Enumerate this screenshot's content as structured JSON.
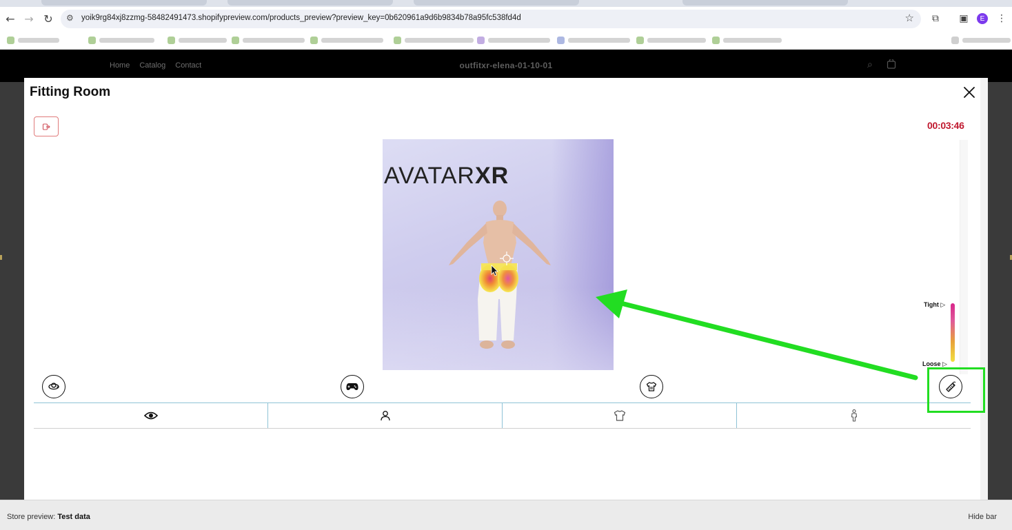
{
  "browser": {
    "url": "yoik9rg84xj8zzmg-58482491473.shopifypreview.com/products_preview?preview_key=0b620961a9d6b9834b78a95fc538fd4d",
    "profile_initial": "E",
    "icons": [
      "back-icon",
      "forward-icon",
      "reload-icon",
      "site-info-icon",
      "bookmark-star-icon",
      "extensions-icon",
      "sidepanel-icon",
      "kebab-menu-icon"
    ]
  },
  "store": {
    "nav": [
      "Home",
      "Catalog",
      "Contact"
    ],
    "title": "outfitxr-elena-01-10-01",
    "icons": [
      "search-icon",
      "cart-icon"
    ]
  },
  "modal": {
    "title": "Fitting Room",
    "timer": "00:03:46",
    "brand_logo_light": "AVATAR",
    "brand_logo_bold": "XR",
    "fit_legend": {
      "tight_label": "Tight",
      "loose_label": "Loose",
      "gradient_colors": [
        "#d8268a",
        "#e8a13a",
        "#f2e040"
      ]
    },
    "controls": [
      "rotate-icon",
      "gamepad-icon",
      "shirt-swap-icon",
      "measuring-tape-icon"
    ],
    "tabs": [
      "eye-icon",
      "person-icon",
      "tshirt-icon",
      "body-figure-icon"
    ]
  },
  "preview_bar": {
    "label": "Store preview:",
    "value": "Test data",
    "hide": "Hide bar"
  },
  "colors": {
    "timer": "#c0192f",
    "exit_button_border": "#e07a7a",
    "annotation": "#22dd22",
    "tab_divider": "#8ec2d6"
  }
}
